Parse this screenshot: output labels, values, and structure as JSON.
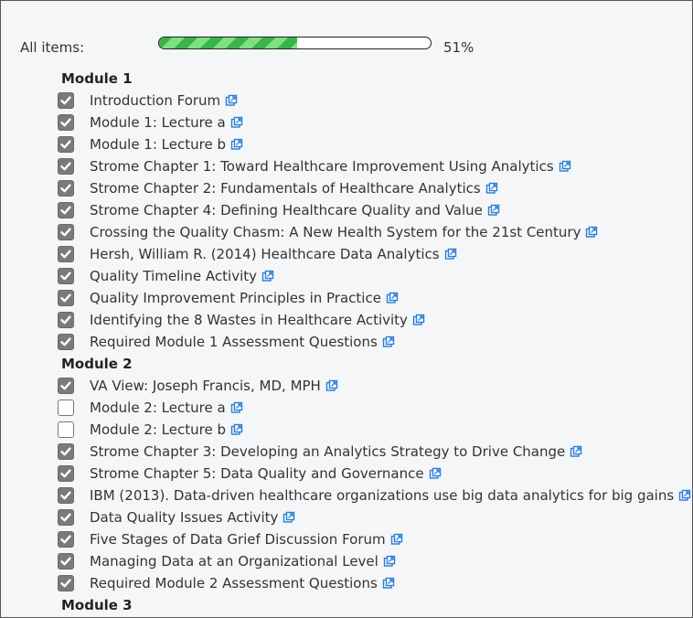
{
  "progress": {
    "label": "All items:",
    "percent_text": "51%",
    "fraction": 0.51
  },
  "modules": [
    {
      "title": "Module 1",
      "items": [
        {
          "label": "Introduction Forum",
          "checked": true
        },
        {
          "label": "Module 1: Lecture a",
          "checked": true
        },
        {
          "label": "Module 1: Lecture b",
          "checked": true
        },
        {
          "label": "Strome Chapter 1: Toward Healthcare Improvement Using Analytics",
          "checked": true
        },
        {
          "label": "Strome Chapter 2: Fundamentals of Healthcare Analytics",
          "checked": true
        },
        {
          "label": "Strome Chapter 4: Defining Healthcare Quality and Value",
          "checked": true
        },
        {
          "label": "Crossing the Quality Chasm: A New Health System for the 21st Century",
          "checked": true
        },
        {
          "label": "Hersh, William R. (2014) Healthcare Data Analytics",
          "checked": true
        },
        {
          "label": "Quality Timeline Activity",
          "checked": true
        },
        {
          "label": "Quality Improvement Principles in Practice",
          "checked": true
        },
        {
          "label": "Identifying the 8 Wastes in Healthcare Activity",
          "checked": true
        },
        {
          "label": "Required Module 1 Assessment Questions",
          "checked": true
        }
      ]
    },
    {
      "title": "Module 2",
      "items": [
        {
          "label": "VA View: Joseph Francis, MD, MPH",
          "checked": true
        },
        {
          "label": "Module 2: Lecture a",
          "checked": false
        },
        {
          "label": "Module 2: Lecture b",
          "checked": false
        },
        {
          "label": "Strome Chapter 3: Developing an Analytics Strategy to Drive Change",
          "checked": true
        },
        {
          "label": "Strome Chapter 5: Data Quality and Governance",
          "checked": true
        },
        {
          "label": "IBM (2013). Data-driven healthcare organizations use big data analytics for big gains",
          "checked": true
        },
        {
          "label": "Data Quality Issues Activity",
          "checked": true
        },
        {
          "label": "Five Stages of Data Grief Discussion Forum",
          "checked": true
        },
        {
          "label": "Managing Data at an Organizational Level",
          "checked": true
        },
        {
          "label": "Required Module 2 Assessment Questions",
          "checked": true
        }
      ]
    },
    {
      "title": "Module 3",
      "items": []
    }
  ],
  "icons": {
    "checkbox_checked": "checkmark-icon",
    "external_link": "external-link-icon"
  },
  "colors": {
    "progress_fill": "#3bb34a",
    "link_icon": "#2a7fd4",
    "checkbox_checked": "#7a7a7a"
  }
}
